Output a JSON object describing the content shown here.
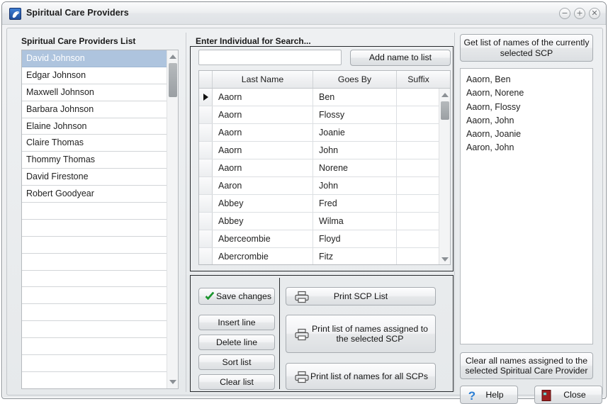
{
  "window": {
    "title": "Spiritual Care Providers",
    "icon": "dove-icon",
    "controls": [
      {
        "name": "minimize",
        "glyph": "−"
      },
      {
        "name": "maximize",
        "glyph": "+"
      },
      {
        "name": "close",
        "glyph": "✕"
      }
    ]
  },
  "left_panel": {
    "label": "Spiritual Care Providers List",
    "selected_index": 0,
    "items": [
      "David Johnson",
      "Edgar Johnson",
      "Maxwell Johnson",
      "Barbara Johnson",
      "Elaine Johnson",
      "Claire Thomas",
      "Thommy Thomas",
      "David Firestone",
      "Robert Goodyear"
    ],
    "blank_rows": 11
  },
  "search": {
    "label": "Enter Individual for Search...",
    "value": "",
    "placeholder": "",
    "add_button": "Add name to list"
  },
  "grid": {
    "columns": [
      "Last Name",
      "Goes By",
      "Suffix"
    ],
    "selected_row": 0,
    "rows": [
      {
        "last_name": "Aaorn",
        "goes_by": "Ben",
        "suffix": ""
      },
      {
        "last_name": "Aaorn",
        "goes_by": "Flossy",
        "suffix": ""
      },
      {
        "last_name": "Aaorn",
        "goes_by": "Joanie",
        "suffix": ""
      },
      {
        "last_name": "Aaorn",
        "goes_by": "John",
        "suffix": ""
      },
      {
        "last_name": "Aaorn",
        "goes_by": "Norene",
        "suffix": ""
      },
      {
        "last_name": "Aaron",
        "goes_by": "John",
        "suffix": ""
      },
      {
        "last_name": "Abbey",
        "goes_by": "Fred",
        "suffix": ""
      },
      {
        "last_name": "Abbey",
        "goes_by": "Wilma",
        "suffix": ""
      },
      {
        "last_name": "Aberceombie",
        "goes_by": "Floyd",
        "suffix": ""
      },
      {
        "last_name": "Abercrombie",
        "goes_by": "Fitz",
        "suffix": ""
      }
    ]
  },
  "actions": {
    "save_changes": "Save changes",
    "insert_line": "Insert line",
    "delete_line": "Delete line",
    "sort_list": "Sort list",
    "clear_list": "Clear list",
    "print_scp_list": "Print SCP List",
    "print_assigned": "Print list of names assigned to\nthe selected SCP",
    "print_all": "Print list of names for all SCPs"
  },
  "right_panel": {
    "get_list_button": "Get list of names of the currently\nselected SCP",
    "names": [
      "Aaorn, Ben",
      "Aaorn, Norene",
      "Aaorn, Flossy",
      "Aaorn, John",
      "Aaorn, Joanie",
      "Aaron, John"
    ],
    "clear_all_button": "Clear all names assigned to the\nselected Spiritual Care Provider",
    "help_button": "Help",
    "close_button": "Close"
  },
  "colors": {
    "selection": "#aec4de",
    "accent_blue": "#1f4e9c",
    "check_green": "#1a9b2e",
    "door_red": "#9e1f1f",
    "help_blue": "#2b7fd4"
  }
}
